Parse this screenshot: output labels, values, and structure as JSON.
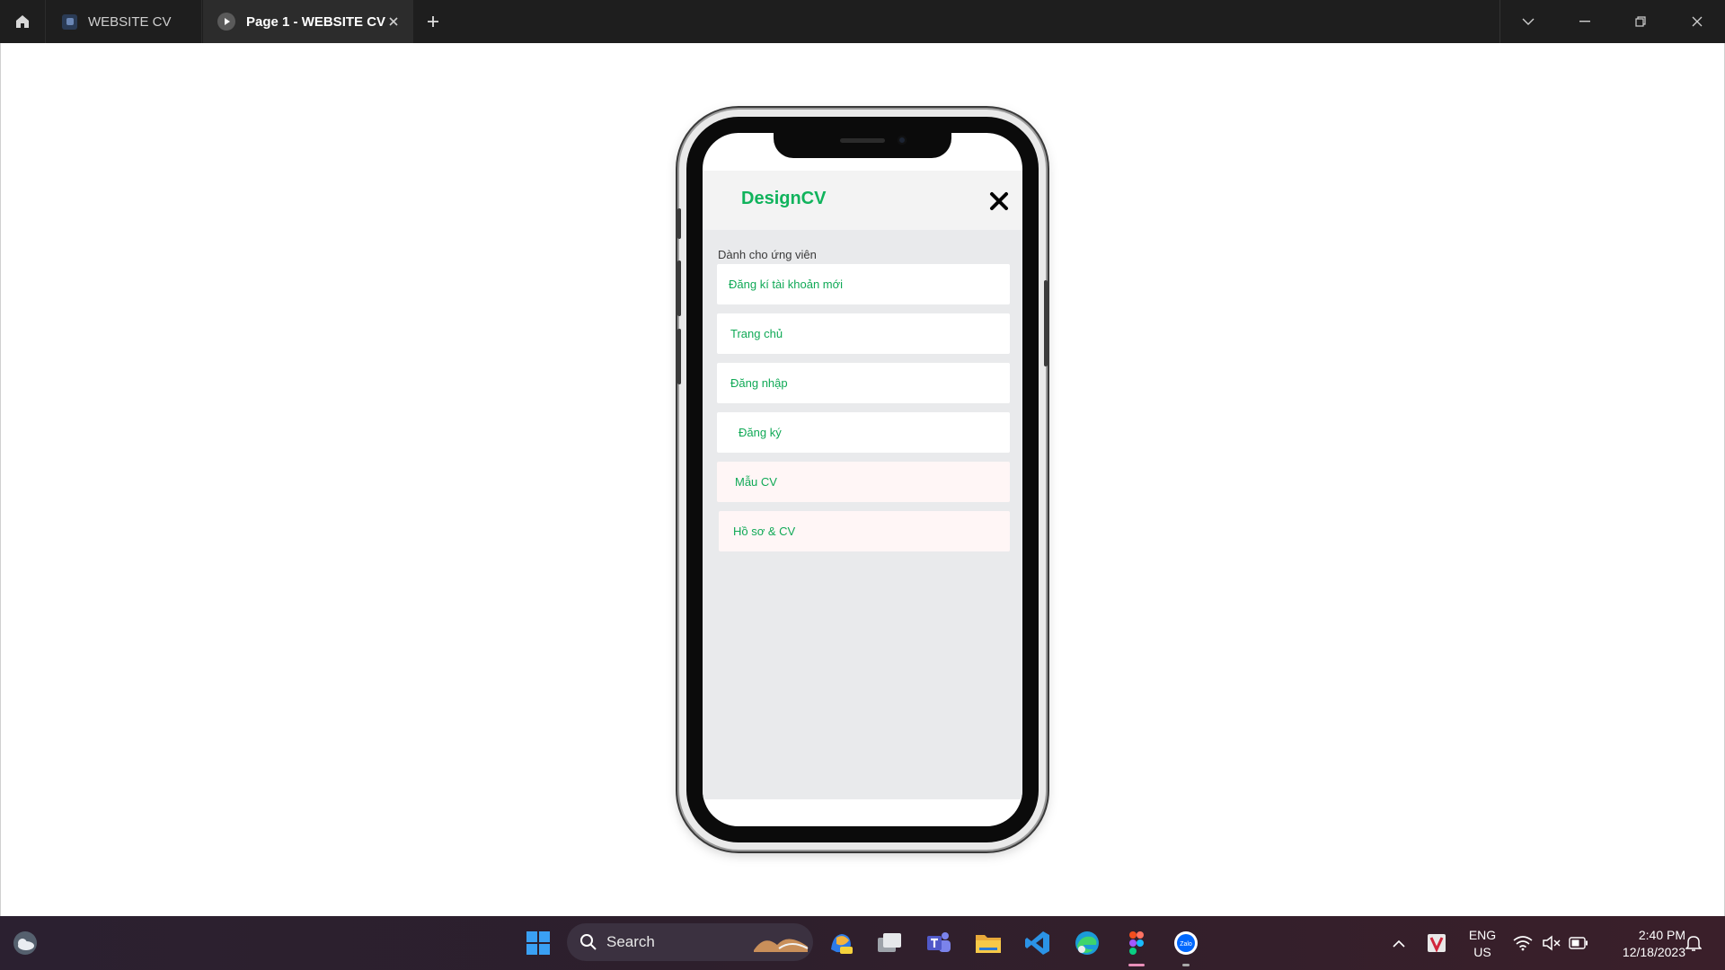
{
  "titlebar": {
    "tabs": [
      {
        "label": "WEBSITE CV"
      },
      {
        "label": "Page 1 - WEBSITE CV"
      }
    ]
  },
  "app": {
    "brand": "DesignCV",
    "section_label": "Dành cho ứng viên",
    "menu": [
      {
        "label": "Đăng kí tài khoản mới"
      },
      {
        "label": "Trang chủ"
      },
      {
        "label": "Đăng nhập"
      },
      {
        "label": "Đăng ký"
      },
      {
        "label": "Mẫu CV"
      },
      {
        "label": "Hồ sơ & CV"
      }
    ],
    "colors": {
      "brand": "#10b35c",
      "menu_text": "#10a956"
    }
  },
  "taskbar": {
    "search_placeholder": "Search",
    "lang_line1": "ENG",
    "lang_line2": "US",
    "time": "2:40 PM",
    "date": "12/18/2023",
    "apps": [
      "weather-icon",
      "windows-start-icon",
      "copilot-icon",
      "task-view-icon",
      "teams-icon",
      "file-explorer-icon",
      "vscode-icon",
      "edge-icon",
      "figma-icon",
      "zalo-icon"
    ]
  }
}
